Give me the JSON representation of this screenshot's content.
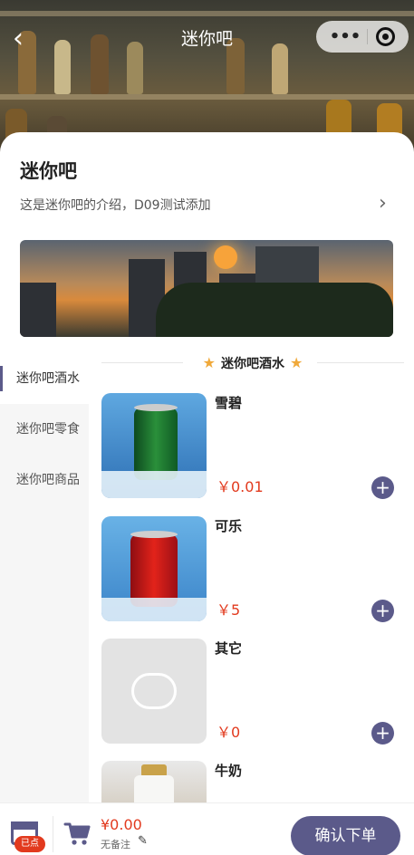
{
  "nav": {
    "title": "迷你吧",
    "back_icon": "chevron-left-icon",
    "more_icon": "more-dots-icon",
    "target_icon": "target-circle-icon"
  },
  "store": {
    "name": "迷你吧",
    "intro": "这是迷你吧的介绍，D09测试添加",
    "intro_arrow_icon": "chevron-right-icon"
  },
  "sidebar": {
    "items": [
      {
        "label": "迷你吧酒水",
        "active": true
      },
      {
        "label": "迷你吧零食",
        "active": false
      },
      {
        "label": "迷你吧商品",
        "active": false
      }
    ]
  },
  "section": {
    "title": "迷你吧酒水",
    "star_icon": "star-icon"
  },
  "products": [
    {
      "name": "雪碧",
      "price": "￥0.01",
      "image": "sprite-can"
    },
    {
      "name": "可乐",
      "price": "￥5",
      "image": "coca-cola-can"
    },
    {
      "name": "其它",
      "price": "￥0",
      "image": "placeholder"
    },
    {
      "name": "牛奶",
      "price": "",
      "image": "milk-bottle"
    }
  ],
  "bottom": {
    "ordered_badge": "已点",
    "total": "¥0.00",
    "remark": "无备注",
    "confirm_label": "确认下单",
    "edit_icon": "pencil-icon"
  },
  "colors": {
    "accent": "#5b5a8a",
    "price": "#e23a1e",
    "star": "#f0a93a"
  }
}
